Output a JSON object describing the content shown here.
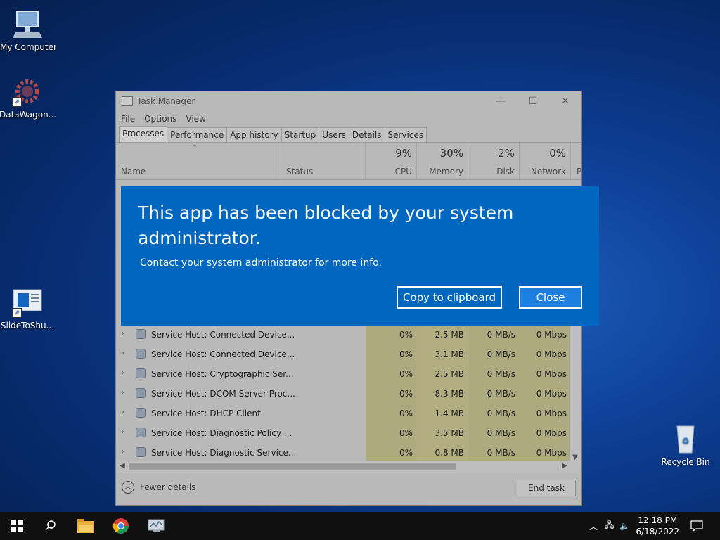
{
  "desktop": {
    "icons": [
      {
        "label": "My Computer"
      },
      {
        "label": "DataWagon..."
      },
      {
        "label": "SlideToShu..."
      },
      {
        "label": "Recycle Bin"
      }
    ]
  },
  "task_manager": {
    "title": "Task Manager",
    "menu": [
      "File",
      "Options",
      "View"
    ],
    "tabs": [
      "Processes",
      "Performance",
      "App history",
      "Startup",
      "Users",
      "Details",
      "Services"
    ],
    "active_tab": "Processes",
    "columns": {
      "name": "Name",
      "status": "Status",
      "cpu": {
        "pct": "9%",
        "label": "CPU"
      },
      "memory": {
        "pct": "30%",
        "label": "Memory"
      },
      "disk": {
        "pct": "2%",
        "label": "Disk"
      },
      "network": {
        "pct": "0%",
        "label": "Network"
      },
      "power_partial": "P"
    },
    "rows": [
      {
        "name": "Service Host: Connected Device...",
        "cpu": "0%",
        "memory": "2.5 MB",
        "disk": "0 MB/s",
        "network": "0 Mbps"
      },
      {
        "name": "Service Host: Connected Device...",
        "cpu": "0%",
        "memory": "3.1 MB",
        "disk": "0 MB/s",
        "network": "0 Mbps"
      },
      {
        "name": "Service Host: Cryptographic Ser...",
        "cpu": "0%",
        "memory": "2.5 MB",
        "disk": "0 MB/s",
        "network": "0 Mbps"
      },
      {
        "name": "Service Host: DCOM Server Proc...",
        "cpu": "0%",
        "memory": "8.3 MB",
        "disk": "0 MB/s",
        "network": "0 Mbps"
      },
      {
        "name": "Service Host: DHCP Client",
        "cpu": "0%",
        "memory": "1.4 MB",
        "disk": "0 MB/s",
        "network": "0 Mbps"
      },
      {
        "name": "Service Host: Diagnostic Policy ...",
        "cpu": "0%",
        "memory": "3.5 MB",
        "disk": "0 MB/s",
        "network": "0 Mbps"
      },
      {
        "name": "Service Host: Diagnostic Service...",
        "cpu": "0%",
        "memory": "0.8 MB",
        "disk": "0 MB/s",
        "network": "0 Mbps"
      }
    ],
    "footer": {
      "fewer_details": "Fewer details",
      "end_task": "End task"
    }
  },
  "dialog": {
    "title": "This app has been blocked by your system administrator.",
    "message": "Contact your system administrator for more info.",
    "copy_button": "Copy to clipboard",
    "close_button": "Close"
  },
  "taskbar": {
    "time": "12:18 PM",
    "date": "6/18/2022"
  },
  "colors": {
    "dialog_bg": "#0067c0",
    "taskbar_bg": "#101010",
    "heat_yellow": "#bdb98a"
  }
}
